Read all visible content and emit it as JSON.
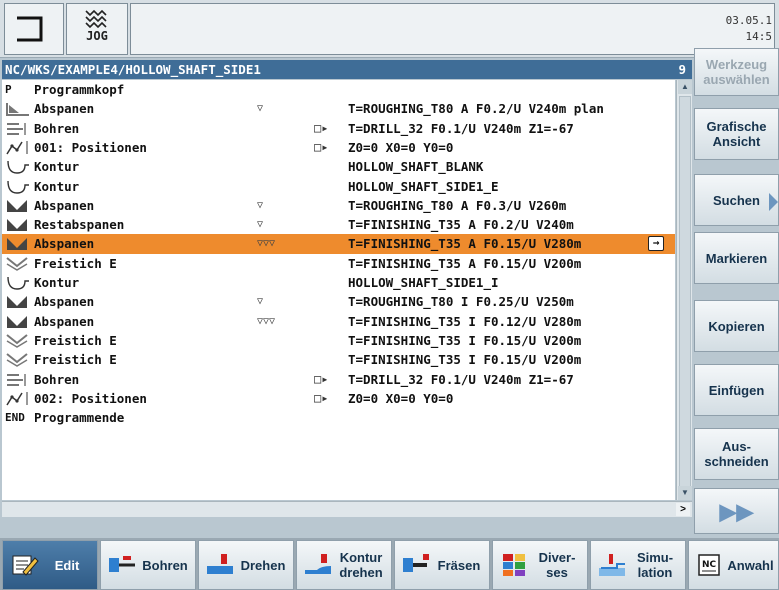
{
  "header": {
    "mode_label": "JOG",
    "date": "03.05.1",
    "time": "14:5"
  },
  "program": {
    "path": "NC/WKS/EXAMPLE4/HOLLOW_SHAFT_SIDE1",
    "number": "9"
  },
  "rows": [
    {
      "icon_label": "P",
      "name": "Programmkopf",
      "tri": "",
      "pre": "",
      "params": ""
    },
    {
      "icon_label": "",
      "name": "Abspanen",
      "tri": "▽",
      "pre": "",
      "params": "T=ROUGHING_T80 A F0.2/U V240m plan"
    },
    {
      "icon_label": "",
      "name": "Bohren",
      "tri": "",
      "pre": "□▸",
      "params": "T=DRILL_32 F0.1/U V240m Z1=-67"
    },
    {
      "icon_label": "",
      "name": "001: Positionen",
      "tri": "",
      "pre": "□▸",
      "params": "Z0=0 X0=0 Y0=0"
    },
    {
      "icon_label": "",
      "name": "Kontur",
      "tri": "",
      "pre": "",
      "params": "HOLLOW_SHAFT_BLANK"
    },
    {
      "icon_label": "",
      "name": "Kontur",
      "tri": "",
      "pre": "",
      "params": "HOLLOW_SHAFT_SIDE1_E"
    },
    {
      "icon_label": "",
      "name": "Abspanen",
      "tri": "▽",
      "pre": "",
      "params": "T=ROUGHING_T80 A F0.3/U V260m"
    },
    {
      "icon_label": "",
      "name": "Restabspanen",
      "tri": "▽",
      "pre": "",
      "params": "T=FINISHING_T35 A F0.2/U V240m"
    },
    {
      "icon_label": "",
      "name": "Abspanen",
      "tri": "▽▽▽",
      "pre": "",
      "params": "T=FINISHING_T35 A F0.15/U V280m"
    },
    {
      "icon_label": "",
      "name": "Freistich E",
      "tri": "",
      "pre": "",
      "params": "T=FINISHING_T35 A F0.15/U V200m"
    },
    {
      "icon_label": "",
      "name": "Kontur",
      "tri": "",
      "pre": "",
      "params": "HOLLOW_SHAFT_SIDE1_I"
    },
    {
      "icon_label": "",
      "name": "Abspanen",
      "tri": "▽",
      "pre": "",
      "params": "T=ROUGHING_T80 I F0.25/U V250m"
    },
    {
      "icon_label": "",
      "name": "Abspanen",
      "tri": "▽▽▽",
      "pre": "",
      "params": "T=FINISHING_T35 I F0.12/U V280m"
    },
    {
      "icon_label": "",
      "name": "Freistich E",
      "tri": "",
      "pre": "",
      "params": "T=FINISHING_T35 I F0.15/U V200m"
    },
    {
      "icon_label": "",
      "name": "Freistich E",
      "tri": "",
      "pre": "",
      "params": "T=FINISHING_T35 I F0.15/U V200m"
    },
    {
      "icon_label": "",
      "name": "Bohren",
      "tri": "",
      "pre": "□▸",
      "params": "T=DRILL_32 F0.1/U V240m Z1=-67"
    },
    {
      "icon_label": "",
      "name": "002: Positionen",
      "tri": "",
      "pre": "□▸",
      "params": "Z0=0 X0=0 Y0=0"
    },
    {
      "icon_label": "END",
      "name": "Programmende",
      "tri": "",
      "pre": "",
      "params": ""
    }
  ],
  "selected_row": 8,
  "row_arrow": "→",
  "hbar_right": ">",
  "vertical_softkeys": {
    "werkzeug": "Werkzeug auswählen",
    "grafische": "Grafische Ansicht",
    "suchen": "Suchen",
    "markieren": "Markieren",
    "kopieren": "Kopieren",
    "einfuegen": "Einfügen",
    "ausschneiden": "Aus- schneiden",
    "weiter": "▶▶"
  },
  "bottom_softkeys": {
    "edit": "Edit",
    "bohren": "Bohren",
    "drehen": "Drehen",
    "kontur_drehen": "Kontur drehen",
    "fraesen": "Fräsen",
    "diverses": "Diver- ses",
    "simulation": "Simu- lation",
    "anwahl": "Anwahl"
  },
  "colors": {
    "path_bar": "#3f6d97",
    "selection": "#ee8b2d",
    "active_softkey": "#2f5b86"
  }
}
